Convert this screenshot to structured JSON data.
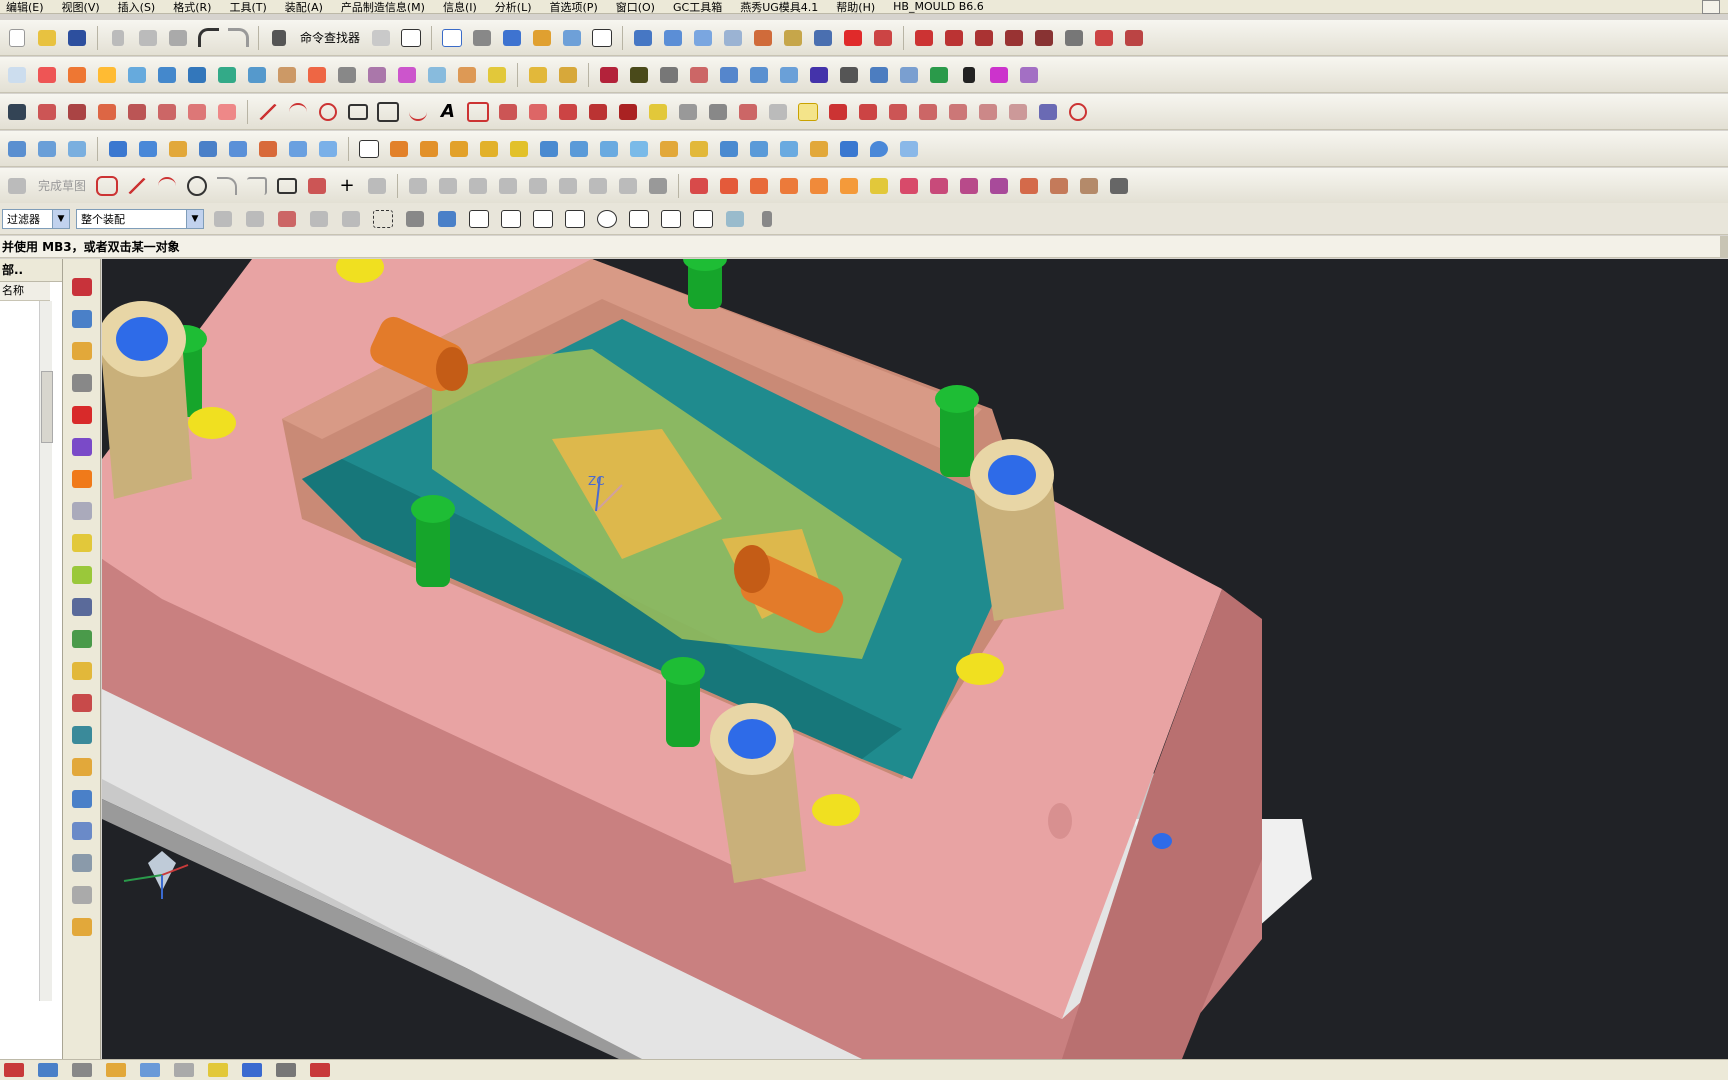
{
  "menu": [
    "编辑(E)",
    "视图(V)",
    "插入(S)",
    "格式(R)",
    "工具(T)",
    "装配(A)",
    "产品制造信息(M)",
    "信息(I)",
    "分析(L)",
    "首选项(P)",
    "窗口(O)",
    "GC工具箱",
    "燕秀UG模具4.1",
    "帮助(H)",
    "HB_MOULD B6.6"
  ],
  "toolbar": {
    "command_finder_label": "命令查找器"
  },
  "selection_bar": {
    "filter_label": "过滤器",
    "scope_value": "整个装配"
  },
  "cue_line": "并使用 MB3，或者双击某一对象",
  "navigator": {
    "title": "部..",
    "column_header": "名称"
  },
  "sketch": {
    "finish_label": "完成草图"
  },
  "viewport": {
    "csys_label": "ZC"
  },
  "colors": {
    "plate": "#e8a3a3",
    "cavity_wall": "#c98a76",
    "core_insert": "#1f8b8e",
    "bolt": "#16a52b",
    "guide_bush": "#d8c08c",
    "bush_center": "#2e6be8",
    "ejector_dot": "#f0e020",
    "slider": "#e37b2a",
    "base": "#dcdcdc",
    "background": "#202226"
  }
}
